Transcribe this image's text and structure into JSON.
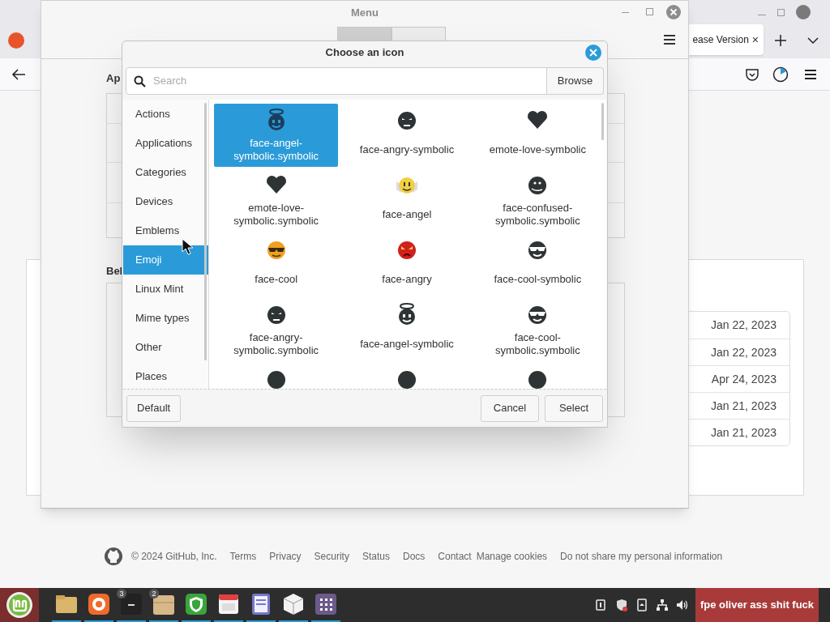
{
  "browser": {
    "tab": {
      "title": "ease Version",
      "close": "×"
    },
    "dates": [
      "Jan 22, 2023",
      "Jan 22, 2023",
      "Apr 24, 2023",
      "Jan 21, 2023",
      "Jan 21, 2023"
    ],
    "footer": {
      "copyright": "© 2024 GitHub, Inc.",
      "links": [
        "Terms",
        "Privacy",
        "Security",
        "Status",
        "Docs",
        "Contact",
        "Manage cookies",
        "Do not share my personal information"
      ]
    }
  },
  "menu_window": {
    "title": "Menu",
    "tabs": [
      {
        "selected": true
      },
      {
        "selected": false
      }
    ],
    "section_1": "Ap",
    "section_2": "Bel"
  },
  "dialog": {
    "title": "Choose an icon",
    "search": {
      "placeholder": "Search"
    },
    "browse": "Browse",
    "categories": [
      {
        "label": "Actions",
        "selected": false
      },
      {
        "label": "Applications",
        "selected": false
      },
      {
        "label": "Categories",
        "selected": false
      },
      {
        "label": "Devices",
        "selected": false
      },
      {
        "label": "Emblems",
        "selected": false
      },
      {
        "label": "Emoji",
        "selected": true
      },
      {
        "label": "Linux Mint",
        "selected": false
      },
      {
        "label": "Mime types",
        "selected": false
      },
      {
        "label": "Other",
        "selected": false
      },
      {
        "label": "Places",
        "selected": false
      }
    ],
    "icons": [
      {
        "label": "face-angel-symbolic.symbolic",
        "selected": true
      },
      {
        "label": "face-angry-symbolic",
        "selected": false
      },
      {
        "label": "emote-love-symbolic",
        "selected": false
      },
      {
        "label": "emote-love-symbolic.symbolic",
        "selected": false
      },
      {
        "label": "face-angel",
        "selected": false
      },
      {
        "label": "face-confused-symbolic.symbolic",
        "selected": false
      },
      {
        "label": "face-cool",
        "selected": false
      },
      {
        "label": "face-angry",
        "selected": false
      },
      {
        "label": "face-cool-symbolic",
        "selected": false
      },
      {
        "label": "face-angry-symbolic.symbolic",
        "selected": false
      },
      {
        "label": "face-angel-symbolic",
        "selected": false
      },
      {
        "label": "face-cool-symbolic.symbolic",
        "selected": false
      },
      {
        "selected": false
      },
      {
        "selected": false
      },
      {
        "selected": false
      }
    ],
    "buttons": {
      "default": "Default",
      "cancel": "Cancel",
      "select": "Select"
    }
  },
  "taskbar": {
    "terminal_badge": "3",
    "files_badge": "2",
    "label": "fpe oliver ass shit fuck"
  }
}
